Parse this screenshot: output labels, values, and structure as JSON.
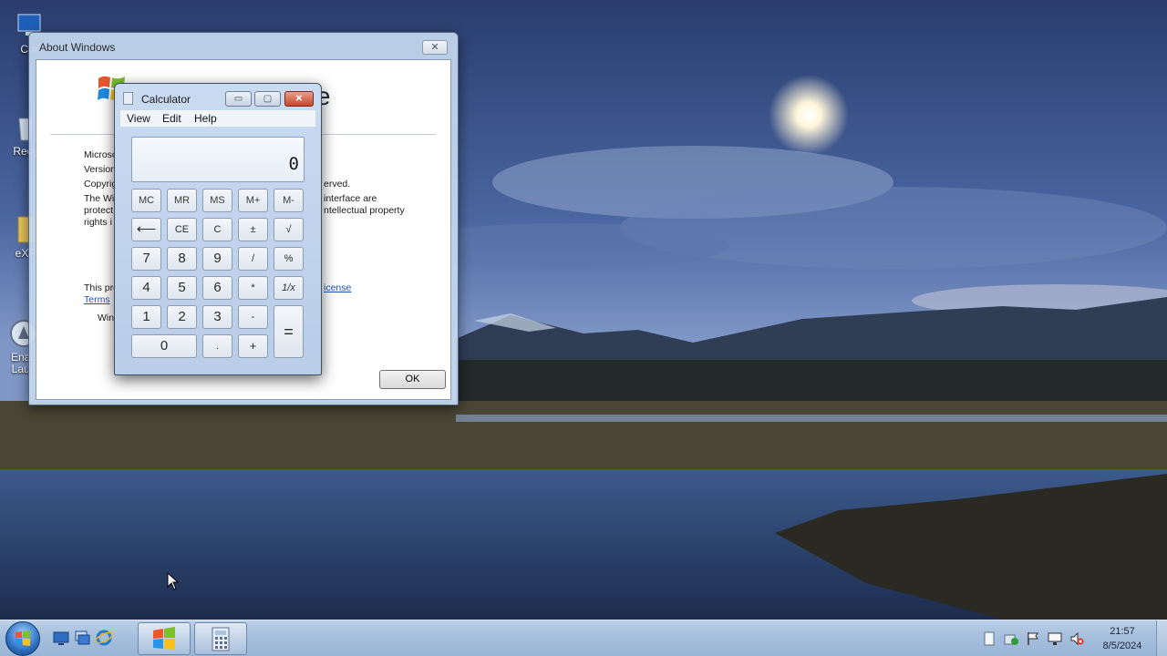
{
  "desktop": {
    "icons": [
      {
        "label": "Cor"
      },
      {
        "label": "Recy"
      },
      {
        "label": "eXP"
      },
      {
        "label": "Enab"
      },
      {
        "label": "Laun"
      }
    ]
  },
  "about_window": {
    "title": "About Windows",
    "close_label": "✕",
    "brand": "ltimate",
    "lines_left": [
      "Microso",
      "Version",
      "Copyrig",
      "The Wi",
      "protect",
      "rights i"
    ],
    "lines_right": [
      "erved.",
      "interface are",
      "ntellectual property"
    ],
    "license_left": "This pro",
    "terms_link": "Terms",
    "license_link": "icense",
    "user_prefix": "Wind",
    "ok_label": "OK"
  },
  "calculator": {
    "title": "Calculator",
    "min_label": "▭",
    "max_label": "▢",
    "close_label": "✕",
    "menus": [
      "View",
      "Edit",
      "Help"
    ],
    "display_value": "0",
    "buttons": {
      "mc": "MC",
      "mr": "MR",
      "ms": "MS",
      "mplus": "M+",
      "mminus": "M-",
      "back": "⟵",
      "ce": "CE",
      "c": "C",
      "plusminus": "±",
      "sqrt": "√",
      "n7": "7",
      "n8": "8",
      "n9": "9",
      "div": "/",
      "pct": "%",
      "n4": "4",
      "n5": "5",
      "n6": "6",
      "mul": "*",
      "recip": "1/x",
      "n1": "1",
      "n2": "2",
      "n3": "3",
      "sub": "-",
      "eq": "=",
      "n0": "0",
      "dot": ".",
      "add": "+"
    }
  },
  "taskbar": {
    "clock_time": "21:57",
    "clock_date": "8/5/2024"
  },
  "colors": {
    "accent": "#2c6fc0",
    "taskbar": "#a6bfdd",
    "window_frame": "#c4d7ee",
    "close_red": "#c8462c"
  },
  "icons": {
    "desktop": [
      "computer-icon",
      "recycle-bin-icon",
      "folder-icon",
      "launcher-icon"
    ],
    "quick_launch": [
      "show-desktop-icon",
      "switch-windows-icon",
      "internet-explorer-icon"
    ],
    "tray": [
      "action-center-icon",
      "security-icon",
      "flag-icon",
      "network-icon",
      "volume-muted-icon"
    ]
  }
}
